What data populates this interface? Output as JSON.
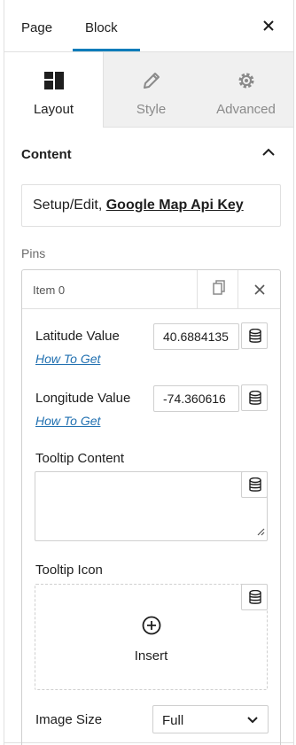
{
  "header": {
    "tabs": [
      {
        "label": "Page",
        "active": false
      },
      {
        "label": "Block",
        "active": true
      }
    ],
    "close_icon": "close-icon",
    "accent_color": "#007cba"
  },
  "block_tabs": [
    {
      "label": "Layout",
      "icon": "layout-icon",
      "active": true
    },
    {
      "label": "Style",
      "icon": "pencil-icon",
      "active": false
    },
    {
      "label": "Advanced",
      "icon": "gear-icon",
      "active": false
    }
  ],
  "content_section": {
    "title": "Content",
    "toggle_icon": "chevron-up-icon",
    "notice_prefix": "Setup/Edit, ",
    "notice_link": "Google Map Api Key"
  },
  "pins": {
    "label": "Pins",
    "item": {
      "title": "Item 0",
      "duplicate_icon": "duplicate-icon",
      "remove_icon": "close-icon",
      "latitude": {
        "label": "Latitude Value",
        "value": "40.6884135",
        "help_link": "How To Get",
        "dynamic_icon": "database-icon"
      },
      "longitude": {
        "label": "Longitude Value",
        "value": "-74.360616",
        "help_link": "How To Get",
        "dynamic_icon": "database-icon"
      },
      "tooltip_content": {
        "label": "Tooltip Content",
        "value": "",
        "dynamic_icon": "database-icon"
      },
      "tooltip_icon": {
        "label": "Tooltip Icon",
        "insert_label": "Insert",
        "insert_icon": "plus-circle-icon",
        "dynamic_icon": "database-icon"
      },
      "image_size": {
        "label": "Image Size",
        "value": "Full"
      }
    }
  },
  "link_color": "#2271b1"
}
